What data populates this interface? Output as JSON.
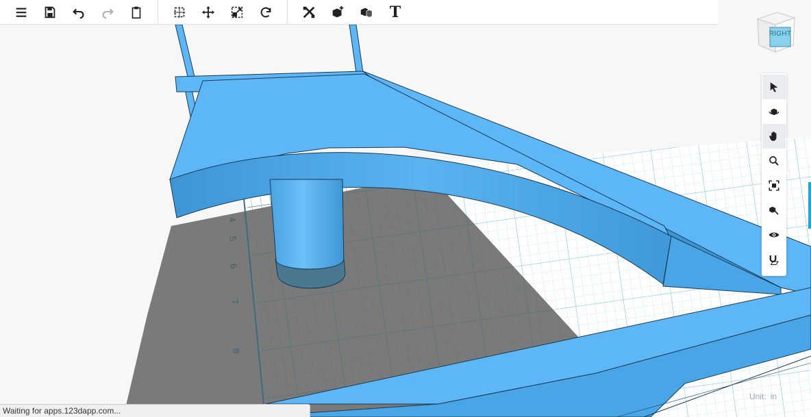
{
  "toolbar": {
    "groups": [
      {
        "buttons": [
          {
            "icon": "menu-icon"
          },
          {
            "icon": "save-icon"
          },
          {
            "icon": "undo-icon"
          },
          {
            "icon": "redo-icon",
            "disabled": true
          },
          {
            "icon": "clipboard-icon"
          }
        ]
      },
      {
        "buttons": [
          {
            "icon": "group-icon"
          },
          {
            "icon": "move-icon"
          },
          {
            "icon": "scale-icon"
          },
          {
            "icon": "rotate-icon"
          }
        ]
      },
      {
        "buttons": [
          {
            "icon": "tools-icon"
          },
          {
            "icon": "add-shape-icon"
          },
          {
            "icon": "combine-icon"
          },
          {
            "icon": "text-tool",
            "label": "T"
          }
        ]
      }
    ]
  },
  "viewcube": {
    "face_label": "RIGHT"
  },
  "sidebar": {
    "tools": [
      {
        "icon": "select-arrow-icon",
        "active": true
      },
      {
        "icon": "orbit-icon"
      },
      {
        "icon": "pan-hand-icon",
        "active": true
      },
      {
        "icon": "zoom-icon"
      },
      {
        "icon": "fit-view-icon"
      },
      {
        "icon": "view-selected-icon"
      },
      {
        "icon": "visibility-eye-icon"
      },
      {
        "icon": "snap-magnet-icon"
      }
    ]
  },
  "ruler": {
    "marks": [
      "4",
      "5",
      "6",
      "7",
      "8"
    ]
  },
  "unit": {
    "label": "Unit:",
    "value": "in"
  },
  "status": {
    "text": "Waiting for apps.123dapp.com..."
  },
  "colors": {
    "shape_blue": "#5db6f5",
    "shape_blue_dark": "#3d95d6",
    "grid_blue": "#9fd5ea",
    "shadow": "#7a7a7a",
    "accent": "#2aa3c9"
  }
}
